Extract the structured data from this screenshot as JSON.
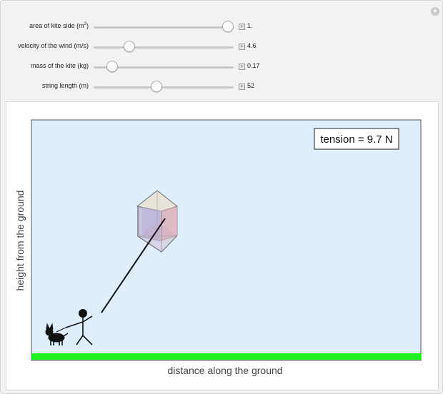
{
  "controls": [
    {
      "label_main": "area of kite side (m",
      "label_sup": "2",
      "label_tail": ")",
      "value": "1.",
      "fraction": 0.96
    },
    {
      "label_main": "velocity of the wind (m/s)",
      "label_sup": "",
      "label_tail": "",
      "value": "4.6",
      "fraction": 0.26
    },
    {
      "label_main": "mass of the kite (kg)",
      "label_sup": "",
      "label_tail": "",
      "value": "0.17",
      "fraction": 0.13
    },
    {
      "label_main": "string length (m)",
      "label_sup": "",
      "label_tail": "",
      "value": "52",
      "fraction": 0.45
    }
  ],
  "plot": {
    "tension_label": "tension = 9.7 N",
    "xlabel": "distance along the ground",
    "ylabel": "height from the ground",
    "sky_color": "#deeefd",
    "ground_color": "#1ef01e"
  },
  "icons": {
    "options": "plus-circle-icon",
    "stepper": "plus-box-icon"
  }
}
